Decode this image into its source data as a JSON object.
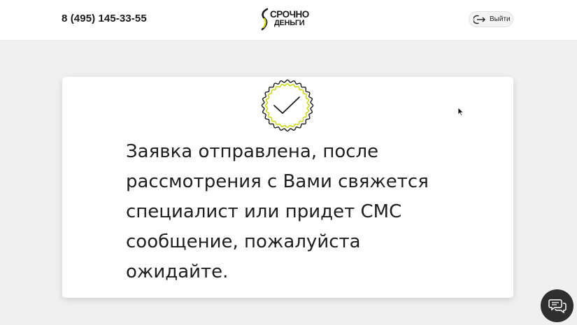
{
  "header": {
    "phone": "8 (495) 145-33-55",
    "logo": {
      "line1": "СРОЧНО",
      "line2": "ДЕНЬГИ",
      "accent_color": "#c8d400"
    },
    "logout_label": "Выйти"
  },
  "main": {
    "status_icon": "check-seal-icon",
    "message": "Заявка отправлена, после рассмотрения с Вами свяжется специалист или придет СМС сообщение, пожалуйста ожидайте."
  },
  "chat": {
    "icon": "chat-bubbles-icon"
  },
  "colors": {
    "background": "#f0f0f0",
    "card": "#ffffff",
    "dark": "#2f2f2f",
    "accent": "#c8d400"
  }
}
